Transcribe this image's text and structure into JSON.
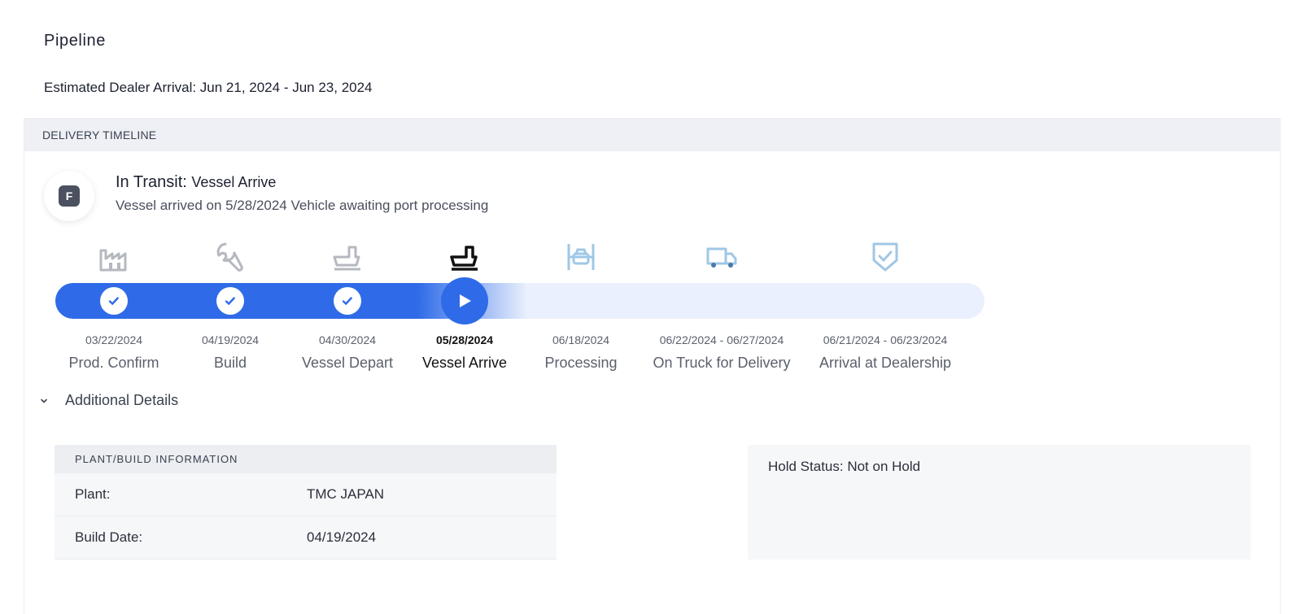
{
  "page": {
    "title": "Pipeline",
    "eta_label": "Estimated Dealer Arrival: Jun 21, 2024 - Jun 23, 2024"
  },
  "timeline": {
    "header": "DELIVERY TIMELINE",
    "badge_letter": "F",
    "status_prefix": "In Transit:",
    "status_stage": "Vessel Arrive",
    "status_description": "Vessel arrived on 5/28/2024 Vehicle awaiting port processing",
    "completed_color": "#2f6be8",
    "pending_color": "#eaf0fd",
    "steps": [
      {
        "date": "03/22/2024",
        "label": "Prod. Confirm",
        "state": "done",
        "icon": "factory-icon"
      },
      {
        "date": "04/19/2024",
        "label": "Build",
        "state": "done",
        "icon": "wrench-icon"
      },
      {
        "date": "04/30/2024",
        "label": "Vessel Depart",
        "state": "done",
        "icon": "ship-icon"
      },
      {
        "date": "05/28/2024",
        "label": "Vessel Arrive",
        "state": "current",
        "icon": "ship-icon"
      },
      {
        "date": "06/18/2024",
        "label": "Processing",
        "state": "pending",
        "icon": "car-processing-icon"
      },
      {
        "date": "06/22/2024 - 06/27/2024",
        "label": "On Truck for Delivery",
        "state": "pending",
        "icon": "truck-icon"
      },
      {
        "date": "06/21/2024 - 06/23/2024",
        "label": "Arrival at Dealership",
        "state": "pending",
        "icon": "shield-check-icon"
      }
    ]
  },
  "details": {
    "toggle_label": "Additional Details",
    "plant_header": "PLANT/BUILD INFORMATION",
    "rows": [
      {
        "key": "Plant:",
        "value": "TMC JAPAN"
      },
      {
        "key": "Build Date:",
        "value": "04/19/2024"
      }
    ],
    "hold_status": "Hold Status: Not on Hold"
  }
}
